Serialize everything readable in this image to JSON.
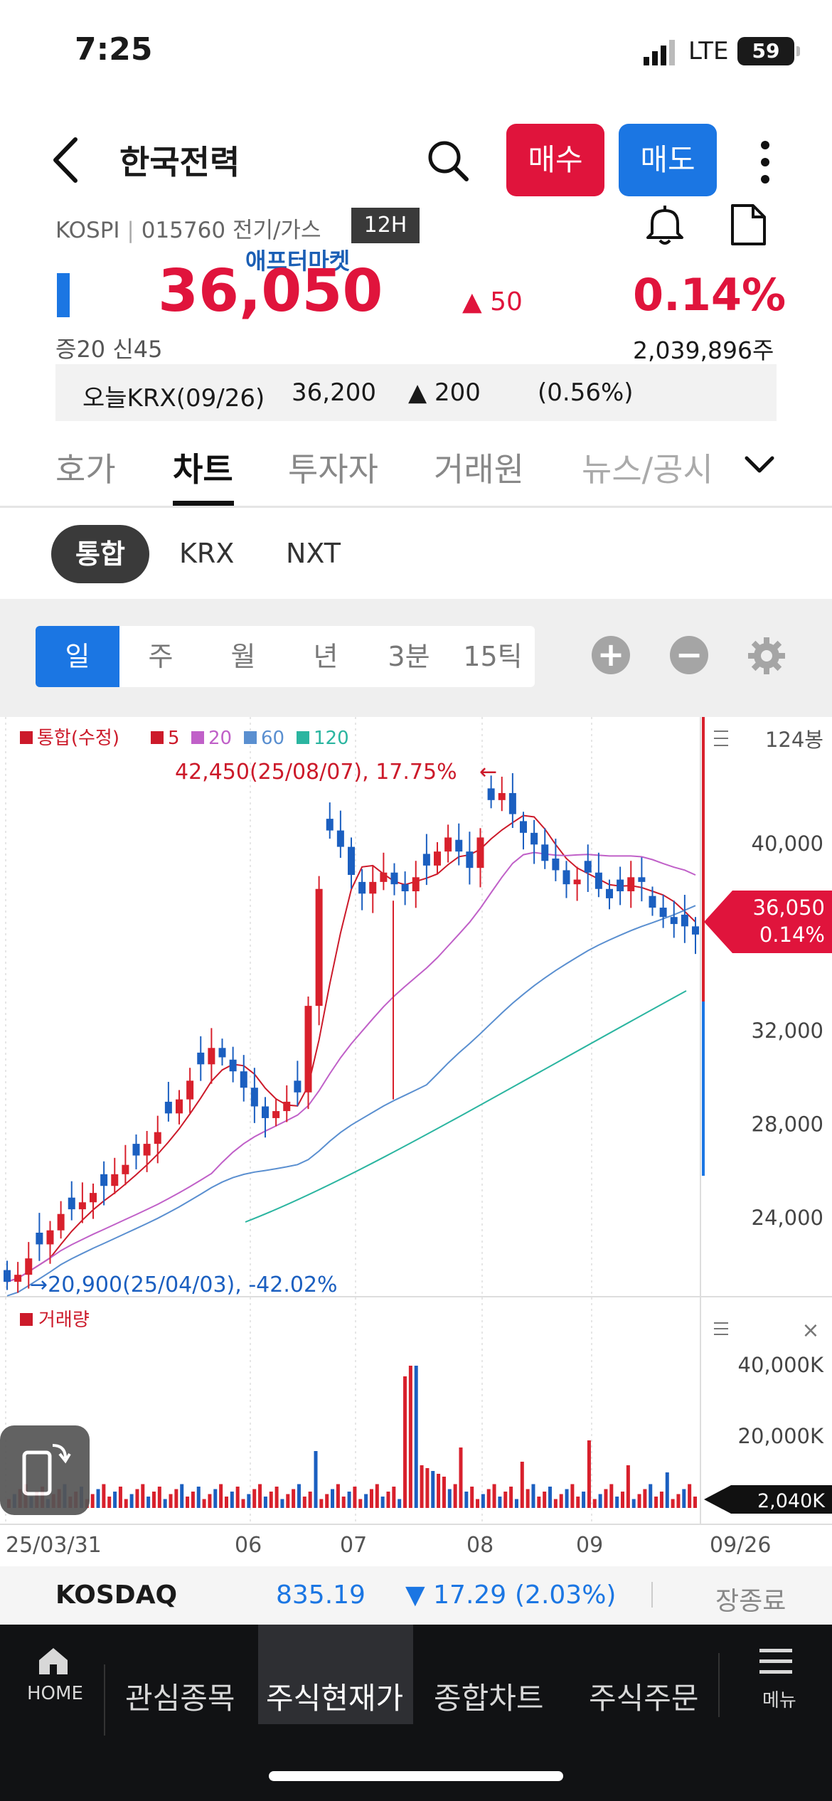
{
  "status_bar": {
    "time": "7:25",
    "network": "LTE",
    "battery": "59"
  },
  "header": {
    "back_icon": "chevron-left-icon",
    "title": "한국전력",
    "search_icon": "search-icon",
    "buy_label": "매수",
    "sell_label": "매도",
    "more_icon": "more-vertical-icon"
  },
  "stock": {
    "market": "KOSPI",
    "code": "015760",
    "sector": "전기/가스",
    "session_badge": "12H",
    "after_market_label": "애프터마켓",
    "price": "36,050",
    "change": "▲ 50",
    "change_rate": "0.14%",
    "margin_info": "증20  신45",
    "volume": "2,039,896주",
    "alert_icon": "bell-icon",
    "doc_icon": "document-icon"
  },
  "krx_today": {
    "label": "오늘KRX(09/26)",
    "price": "36,200",
    "change": "▲ 200",
    "rate": "(0.56%)"
  },
  "tabs": [
    {
      "label": "호가"
    },
    {
      "label": "차트"
    },
    {
      "label": "투자자"
    },
    {
      "label": "거래원"
    },
    {
      "label": "뉴스/공시"
    }
  ],
  "active_tab": "차트",
  "exchanges": [
    "통합",
    "KRX",
    "NXT"
  ],
  "periods": [
    "일",
    "주",
    "월",
    "년",
    "3분",
    "15틱"
  ],
  "chart_controls": {
    "zoom_in_icon": "plus-circle-icon",
    "zoom_out_icon": "minus-circle-icon",
    "settings_icon": "gear-icon"
  },
  "chart_data": {
    "type": "candlestick",
    "legend": [
      "통합(수정)",
      "5",
      "20",
      "60",
      "120"
    ],
    "legend_colors": [
      "#cc1a2a",
      "#cc1a2a",
      "#c060c8",
      "#5a8fd0",
      "#2bb5a0"
    ],
    "bar_count_label": "124봉",
    "x_ticks": [
      "25/03/31",
      "06",
      "07",
      "08",
      "09",
      "09/26"
    ],
    "y_ticks": [
      "40,000",
      "36,000",
      "32,000",
      "28,000",
      "24,000"
    ],
    "ylim": [
      20000,
      44000
    ],
    "current_price_label": "36,050",
    "current_rate_label": "0.14%",
    "high_annotation": "42,450(25/08/07), 17.75%",
    "low_annotation": "20,900(25/04/03), -42.02%",
    "close_series": [
      21200,
      21500,
      22200,
      22800,
      23400,
      24100,
      24300,
      24600,
      25000,
      25300,
      25800,
      26200,
      26600,
      27100,
      27600,
      28400,
      29000,
      29800,
      30500,
      31200,
      30800,
      30200,
      29500,
      28700,
      28200,
      28500,
      28900,
      29300,
      33000,
      38000,
      40500,
      39800,
      38600,
      37800,
      38300,
      38700,
      38200,
      37900,
      38500,
      39000,
      39600,
      40200,
      39600,
      38900,
      40200,
      41800,
      42100,
      41200,
      40400,
      39900,
      39200,
      38800,
      38200,
      38400,
      38700,
      38000,
      37600,
      37900,
      38500,
      38300,
      37200,
      36800,
      36500,
      36400,
      36050
    ],
    "volume_series_label": "거래량",
    "volume_ticks": [
      "40,000K",
      "20,000K"
    ],
    "current_volume_label": "2,040K"
  },
  "index_bar": {
    "name": "KOSDAQ",
    "value": "835.19",
    "change": "▼ 17.29",
    "rate": "(2.03%)",
    "status": "장종료"
  },
  "bottom_nav": [
    {
      "label": "HOME",
      "icon": "home-icon"
    },
    {
      "label": "관심종목"
    },
    {
      "label": "주식현재가"
    },
    {
      "label": "종합차트"
    },
    {
      "label": "주식주문"
    },
    {
      "label": "메뉴",
      "icon": "hamburger-menu-icon"
    }
  ]
}
